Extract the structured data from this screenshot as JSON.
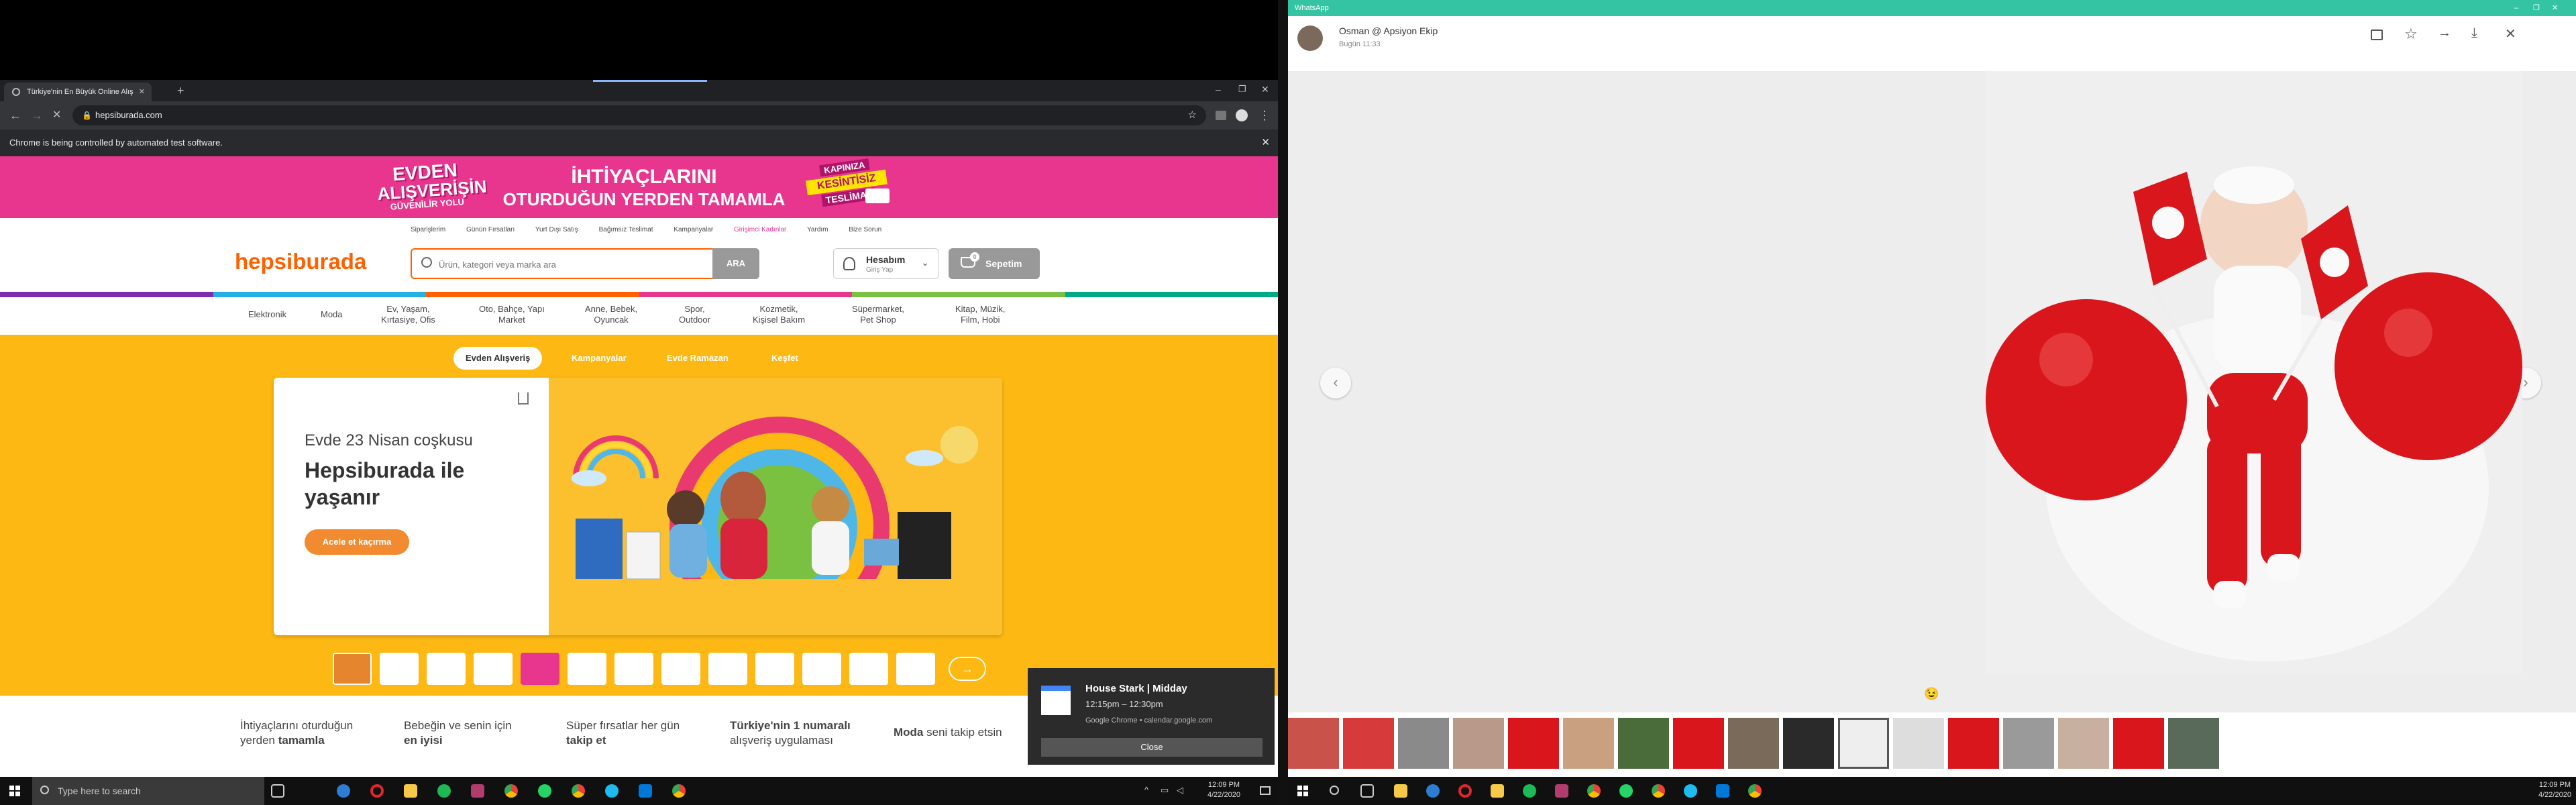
{
  "browser": {
    "tab_title": "Türkiye'nin En Büyük Online Alış",
    "url": "hepsiburada.com",
    "automation_notice": "Chrome is being controlled by automated test software."
  },
  "promo_banner": {
    "left_badge_line1": "EVDEN",
    "left_badge_line2": "ALIŞVERİŞİN",
    "left_badge_line3": "GÜVENİLİR YOLU",
    "headline_line1": "İHTİYAÇLARINI",
    "headline_line2": "OTURDUĞUN YERDEN TAMAMLA",
    "right_badge_line1": "KAPINIZA",
    "right_badge_line2": "KESİNTİSİZ",
    "right_badge_line3": "TESLİMAT"
  },
  "site": {
    "top_links": [
      "Siparişlerim",
      "Günün Fırsatları",
      "Yurt Dışı Satış",
      "Bağımsız Teslimat",
      "Kampanyalar",
      "Girişimci Kadınlar",
      "Yardım",
      "Bize Sorun"
    ],
    "logo": "hepsiburada",
    "search_placeholder": "Ürün, kategori veya marka ara",
    "search_button": "ARA",
    "account_label": "Hesabım",
    "account_sub": "Giriş Yap",
    "cart_label": "Sepetim",
    "cart_count": "0",
    "categories": [
      "Elektronik",
      "Moda",
      "Ev, Yaşam,\nKırtasiye, Ofis",
      "Oto, Bahçe, Yapı\nMarket",
      "Anne, Bebek,\nOyuncak",
      "Spor,\nOutdoor",
      "Kozmetik,\nKişisel Bakım",
      "Süpermarket,\nPet Shop",
      "Kitap, Müzik,\nFilm, Hobi"
    ],
    "rainbow_colors": [
      "#7f2bb0",
      "#25b0e5",
      "#ff6000",
      "#e8368f",
      "#7ac142",
      "#00aa84"
    ]
  },
  "campaign": {
    "tabs": [
      "Evden Alışveriş",
      "Kampanyalar",
      "Evde Ramazan",
      "Keşfet"
    ],
    "subtitle": "Evde 23 Nisan coşkusu",
    "title": "Hepsiburada ile yaşanır",
    "cta": "Acele et kaçırma"
  },
  "bottom_features": [
    {
      "line1": "İhtiyaçlarını oturduğun",
      "line2": "yerden ",
      "bold": "tamamla"
    },
    {
      "line1": "Bebeğin ve senin için",
      "line2": "",
      "bold": "en iyisi"
    },
    {
      "line1": "Süper fırsatlar her gün",
      "line2": "",
      "bold": "takip et"
    },
    {
      "line1": "Türkiye'nin 1 numaralı",
      "line2": "alışveriş uygulaması",
      "bold": ""
    },
    {
      "line1": "Moda",
      "line2": " seni takip etsin",
      "bold": ""
    }
  ],
  "notification": {
    "title": "House Stark | Midday",
    "time": "12:15pm – 12:30pm",
    "source": "Google Chrome • calendar.google.com",
    "close": "Close"
  },
  "taskbar_left": {
    "search_placeholder": "Type here to search",
    "time": "12:09 PM",
    "date": "4/22/2020"
  },
  "whatsapp": {
    "app_title": "WhatsApp",
    "sender": "Osman @ Apsiyon Ekip",
    "timestamp": "Bugün 11:33",
    "caption_emoji": "😉",
    "taskbar_time": "12:09 PM",
    "taskbar_date": "4/22/2020"
  }
}
